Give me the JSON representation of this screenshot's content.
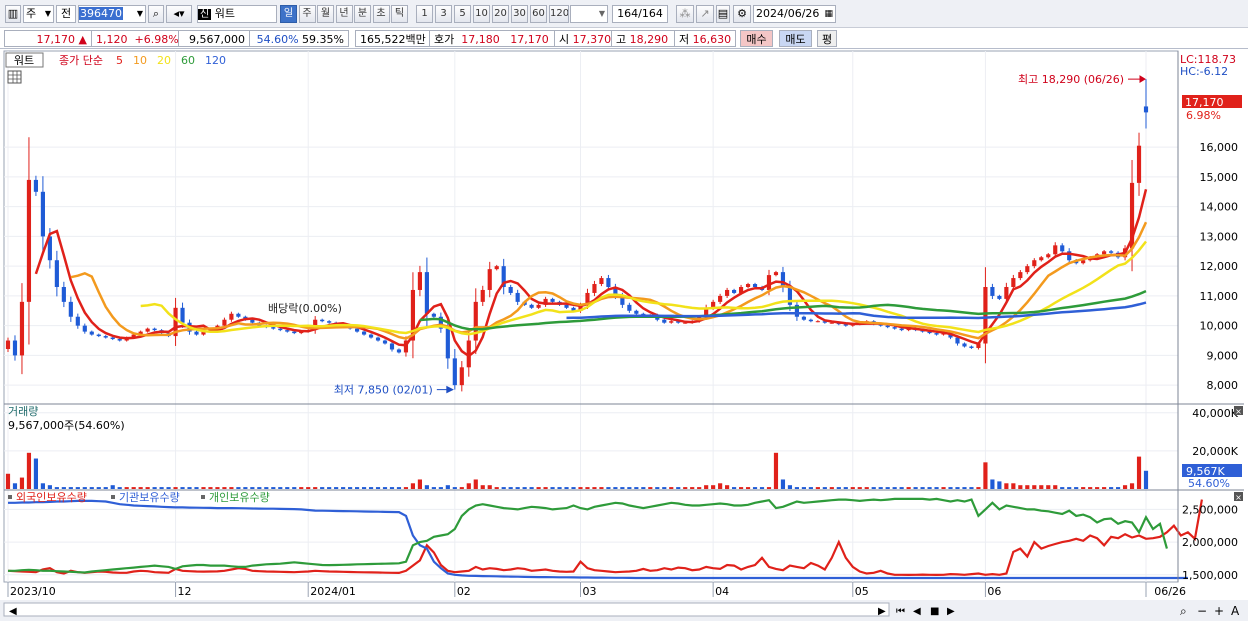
{
  "toolbar": {
    "code": "396470",
    "market_flag": "신",
    "stock_name": "워트",
    "dropdown_main": "주",
    "dropdown_prev": "전",
    "periods": [
      "일",
      "주",
      "월",
      "년",
      "분",
      "초",
      "틱"
    ],
    "active_period": "일",
    "intervals": [
      "1",
      "3",
      "5",
      "10",
      "20",
      "30",
      "60",
      "120"
    ],
    "count_value": "164",
    "count_total": "/164",
    "date": "2024/06/26"
  },
  "quote": {
    "price": "17,170",
    "change": "1,120",
    "change_pct": "+6.98%",
    "volume": "9,567,000",
    "ratio1": "54.60%",
    "ratio2": "59.35%",
    "amount": "165,522백만",
    "bid_label": "호가",
    "bid1": "17,180",
    "bid2": "17,170",
    "open_label": "시",
    "open": "17,370",
    "high_label": "고",
    "high": "18,290",
    "low_label": "저",
    "low": "16,630",
    "buy_label": "매수",
    "sell_label": "매도",
    "eval_label": "평"
  },
  "colors": {
    "up": "#e0211a",
    "down": "#1f5bd6",
    "ma5": "#e0211a",
    "ma10": "#f39a1e",
    "ma20": "#f2e21a",
    "ma60": "#2e9b3a",
    "ma120": "#2f5fd6",
    "foreign": "#e0211a",
    "institution": "#2f5fd6",
    "individual": "#2e9b3a"
  },
  "chart_data": [
    {
      "type": "candlestick",
      "legend": {
        "name": "워트",
        "ma_label": "종가 단순",
        "periods": [
          "5",
          "10",
          "20",
          "60",
          "120"
        ]
      },
      "ylim": [
        7400,
        19200
      ],
      "yticks": [
        "8,000",
        "9,000",
        "10,000",
        "11,000",
        "12,000",
        "13,000",
        "14,000",
        "15,000",
        "16,000"
      ],
      "x_labels": [
        {
          "index": 0,
          "label": "2023/10"
        },
        {
          "index": 24,
          "label": "12"
        },
        {
          "index": 43,
          "label": "2024/01"
        },
        {
          "index": 64,
          "label": "02"
        },
        {
          "index": 82,
          "label": "03"
        },
        {
          "index": 101,
          "label": "04"
        },
        {
          "index": 121,
          "label": "05"
        },
        {
          "index": 140,
          "label": "06"
        },
        {
          "index": 163,
          "label": "06/26"
        }
      ],
      "lc_label": "LC:118.73",
      "hc_label": "HC:-6.12",
      "current_tag": "17,170",
      "current_pct": "6.98%",
      "annotations": {
        "high": "최고 18,290 (06/26)",
        "low": "최저 7,850 (02/01)",
        "dividend": "배당락(0.00%)"
      },
      "close": [
        9500,
        9000,
        10800,
        14900,
        14500,
        13000,
        12200,
        11300,
        10800,
        10300,
        10000,
        9800,
        9700,
        9650,
        9600,
        9550,
        9500,
        9600,
        9700,
        9800,
        9900,
        9850,
        9750,
        9650,
        10600,
        10100,
        9800,
        9700,
        9800,
        9900,
        10000,
        10200,
        10400,
        10300,
        10200,
        10100,
        10000,
        9950,
        9900,
        9850,
        9800,
        9750,
        9800,
        9850,
        10200,
        10150,
        10100,
        10000,
        9950,
        9900,
        9800,
        9700,
        9600,
        9500,
        9400,
        9200,
        9100,
        9500,
        11200,
        11800,
        10400,
        10300,
        9900,
        8900,
        8000,
        8600,
        9500,
        10800,
        11200,
        11900,
        12000,
        11300,
        11100,
        10800,
        10700,
        10600,
        10700,
        10900,
        10800,
        10700,
        10600,
        10500,
        10700,
        11100,
        11400,
        11600,
        11300,
        11000,
        10700,
        10500,
        10400,
        10300,
        10350,
        10200,
        10100,
        10150,
        10100,
        10100,
        10150,
        10300,
        10600,
        10800,
        11000,
        11200,
        11100,
        11300,
        11400,
        11300,
        11200,
        11700,
        11800,
        11300,
        10700,
        10300,
        10200,
        10150,
        10150,
        10100,
        10100,
        10050,
        10000,
        10050,
        10100,
        10150,
        10050,
        10000,
        9950,
        9900,
        9850,
        9900,
        9850,
        9800,
        9750,
        9700,
        9750,
        9600,
        9400,
        9300,
        9250,
        9400,
        11300,
        11000,
        10900,
        11300,
        11600,
        11800,
        12000,
        12200,
        12300,
        12400,
        12700,
        12500,
        12200,
        12100,
        12200,
        12300,
        12400,
        12500,
        12450,
        12300,
        12600,
        14800,
        16050,
        17170
      ],
      "volume": [
        8,
        3,
        6,
        19,
        16,
        3,
        2,
        1,
        1,
        1,
        1,
        1,
        1,
        1,
        1,
        2,
        1,
        1,
        1,
        1,
        1,
        1,
        1,
        1,
        1,
        1,
        1,
        1,
        1,
        1,
        1,
        1,
        1,
        1,
        1,
        1,
        1,
        1,
        1,
        1,
        1,
        1,
        1,
        1,
        1,
        1,
        1,
        1,
        1,
        1,
        1,
        1,
        1,
        1,
        1,
        1,
        1,
        1,
        3,
        5,
        2,
        1,
        1,
        2,
        1,
        1,
        3,
        5,
        2,
        2,
        1,
        1,
        1,
        1,
        1,
        1,
        1,
        1,
        1,
        1,
        1,
        1,
        1,
        1,
        1,
        1,
        1,
        1,
        1,
        1,
        1,
        1,
        1,
        1,
        1,
        1,
        1,
        1,
        1,
        1,
        2,
        2,
        3,
        2,
        1,
        1,
        1,
        1,
        1,
        1,
        19,
        5,
        2,
        1,
        1,
        1,
        1,
        1,
        1,
        1,
        1,
        1,
        1,
        1,
        1,
        1,
        1,
        1,
        1,
        1,
        1,
        1,
        1,
        1,
        1,
        1,
        1,
        1,
        1,
        1,
        14,
        5,
        4,
        3,
        3,
        2,
        2,
        2,
        2,
        2,
        2,
        1,
        1,
        1,
        1,
        1,
        1,
        1,
        1,
        1,
        2,
        3,
        17,
        9.567
      ],
      "volume_unit": "x1000K",
      "volume_label": "거래량",
      "volume_info": "9,567,000주(54.60%)",
      "volume_ticks": [
        "40,000K",
        "20,000K"
      ],
      "volume_tag": "9,567K",
      "volume_pct": "54.60%"
    },
    {
      "type": "line",
      "series": [
        {
          "name": "외국인보유수량",
          "values": [
            1560000,
            1555000,
            1550000,
            1545000,
            1540000,
            1580000,
            1600000,
            1540000,
            1520000,
            1560000,
            1540000,
            1530000,
            1540000,
            1550000,
            1545000,
            1535000,
            1530000,
            1530000,
            1550000,
            1560000,
            1555000,
            1540000,
            1535000,
            1530000,
            1590000,
            1560000,
            1555000,
            1550000,
            1548000,
            1550000,
            1552000,
            1560000,
            1580000,
            1600000,
            1590000,
            1560000,
            1555000,
            1550000,
            1548000,
            1545000,
            1542000,
            1540000,
            1545000,
            1550000,
            1560000,
            1555000,
            1550000,
            1548000,
            1545000,
            1542000,
            1540000,
            1538000,
            1536000,
            1534000,
            1532000,
            1530000,
            1528000,
            1560000,
            1640000,
            1720000,
            1950000,
            1840000,
            1650000,
            1560000,
            1540000,
            1550000,
            1560000,
            1620000,
            1580000,
            1600000,
            1590000,
            1570000,
            1580000,
            1600000,
            1590000,
            1560000,
            1570000,
            1580000,
            1560000,
            1550000,
            1545000,
            1550000,
            1700000,
            1600000,
            1570000,
            1560000,
            1550000,
            1540000,
            1545000,
            1550000,
            1560000,
            1590000,
            1560000,
            1570000,
            1600000,
            1580000,
            1610000,
            1600000,
            1570000,
            1580000,
            1620000,
            1600000,
            1590000,
            1650000,
            1640000,
            1580000,
            1620000,
            1650000,
            1760000,
            1620000,
            1590000,
            1570000,
            1640000,
            1620000,
            1600000,
            1680000,
            1640000,
            1580000,
            1760000,
            2000000,
            1760000,
            1620000,
            1550000,
            1520000,
            1530000,
            1560000,
            1520000,
            1500000,
            1500000,
            1498000,
            1500000,
            1502000,
            1500000,
            1498000,
            1500000,
            1510000,
            1505000,
            1500000,
            1510000,
            1520000,
            1500000,
            1510000,
            1500000,
            1520000,
            1850000,
            1900000,
            1780000,
            2000000,
            1900000,
            1940000,
            1970000,
            2000000,
            2020000,
            2050000,
            2020000,
            2100000,
            2060000,
            1950000,
            2080000,
            2060000,
            2120000,
            2070000,
            2100000,
            2050000,
            2060000,
            2080000,
            2150000,
            2250000,
            2100000,
            2150000,
            2050000,
            2650000
          ]
        },
        {
          "name": "기관보유수량",
          "values": [
            2600000,
            2600000,
            2605000,
            2605000,
            2610000,
            2610000,
            2615000,
            2620000,
            2620000,
            2625000,
            2630000,
            2630000,
            2630000,
            2625000,
            2620000,
            2600000,
            2580000,
            2570000,
            2560000,
            2555000,
            2550000,
            2545000,
            2540000,
            2535000,
            2530000,
            2530000,
            2528000,
            2526000,
            2524000,
            2522000,
            2520000,
            2520000,
            2520000,
            2518000,
            2516000,
            2514000,
            2512000,
            2510000,
            2510000,
            2508000,
            2506000,
            2504000,
            2500000,
            2490000,
            2482000,
            2480000,
            2478000,
            2476000,
            2474000,
            2472000,
            2470000,
            2468000,
            2466000,
            2464000,
            2462000,
            2460000,
            2458000,
            2400000,
            2100000,
            1950000,
            1900000,
            1700000,
            1600000,
            1520000,
            1500000,
            1490000,
            1485000,
            1482000,
            1480000,
            1478000,
            1476000,
            1474000,
            1472000,
            1470000,
            1468000,
            1466000,
            1465000,
            1464000,
            1463000,
            1462000,
            1461000,
            1460000,
            1459000,
            1458000,
            1457000,
            1456000,
            1455000,
            1454000,
            1453000,
            1452000,
            1451000,
            1450000,
            1450000,
            1450000,
            1450000,
            1450000,
            1450000,
            1450000,
            1450000,
            1450000,
            1450000,
            1450000,
            1450000,
            1450000,
            1450000,
            1450000,
            1450000,
            1450000,
            1450000,
            1450000,
            1450000,
            1450000,
            1450000,
            1450000,
            1450000,
            1450000,
            1450000,
            1450000,
            1450000,
            1450000,
            1450000,
            1450000,
            1450000,
            1450000,
            1450000,
            1450000,
            1450000,
            1450000,
            1450000,
            1450000,
            1450000,
            1450000,
            1450000,
            1450000,
            1450000,
            1450000,
            1450000,
            1450000,
            1450000,
            1450000,
            1450000,
            1450000,
            1450000,
            1450000,
            1450000,
            1450000,
            1450000,
            1450000,
            1450000,
            1450000,
            1450000,
            1450000,
            1450000,
            1450000,
            1450000,
            1450000,
            1450000,
            1450000,
            1450000,
            1450000,
            1450000,
            1450000,
            1450000,
            1450000,
            1450000,
            1450000,
            1450000,
            1450000,
            1450000,
            1450000
          ]
        },
        {
          "name": "개인보유수량",
          "values": [
            1560000,
            1560000,
            1570000,
            1575000,
            1570000,
            1560000,
            1560000,
            1555000,
            1550000,
            1545000,
            1540000,
            1535000,
            1550000,
            1560000,
            1570000,
            1580000,
            1590000,
            1600000,
            1610000,
            1620000,
            1630000,
            1640000,
            1630000,
            1620000,
            1590000,
            1630000,
            1640000,
            1650000,
            1650000,
            1640000,
            1640000,
            1640000,
            1630000,
            1620000,
            1620000,
            1640000,
            1650000,
            1660000,
            1665000,
            1670000,
            1680000,
            1690000,
            1680000,
            1670000,
            1660000,
            1650000,
            1648000,
            1650000,
            1652000,
            1655000,
            1660000,
            1662000,
            1665000,
            1668000,
            1670000,
            1672000,
            1675000,
            1700000,
            1950000,
            2000000,
            2020000,
            2080000,
            2100000,
            2120000,
            2200000,
            2400000,
            2500000,
            2560000,
            2580000,
            2560000,
            2540000,
            2520000,
            2510000,
            2500000,
            2520000,
            2540000,
            2530000,
            2520000,
            2500000,
            2510000,
            2520000,
            2560000,
            2520000,
            2500000,
            2540000,
            2560000,
            2580000,
            2600000,
            2590000,
            2560000,
            2540000,
            2520000,
            2540000,
            2560000,
            2580000,
            2600000,
            2590000,
            2570000,
            2560000,
            2560000,
            2570000,
            2580000,
            2590000,
            2580000,
            2560000,
            2560000,
            2570000,
            2600000,
            2620000,
            2640000,
            2520000,
            2540000,
            2580000,
            2620000,
            2600000,
            2610000,
            2620000,
            2630000,
            2640000,
            2650000,
            2650000,
            2640000,
            2630000,
            2640000,
            2650000,
            2640000,
            2650000,
            2660000,
            2660000,
            2660000,
            2660000,
            2660000,
            2650000,
            2660000,
            2640000,
            2620000,
            2640000,
            2620000,
            2650000,
            2400000,
            2500000,
            2600000,
            2500000,
            2560000,
            2540000,
            2520000,
            2500000,
            2500000,
            2480000,
            2470000,
            2450000,
            2430000,
            2480000,
            2400000,
            2420000,
            2380000,
            2300000,
            2350000,
            2360000,
            2280000,
            2320000,
            2300000,
            2150000,
            2380000,
            2200000,
            2280000,
            1900000
          ]
        }
      ],
      "yticks": [
        "2,500,000",
        "2,000,000",
        "1,500,000"
      ],
      "ylim": [
        1420000,
        2720000
      ]
    }
  ]
}
